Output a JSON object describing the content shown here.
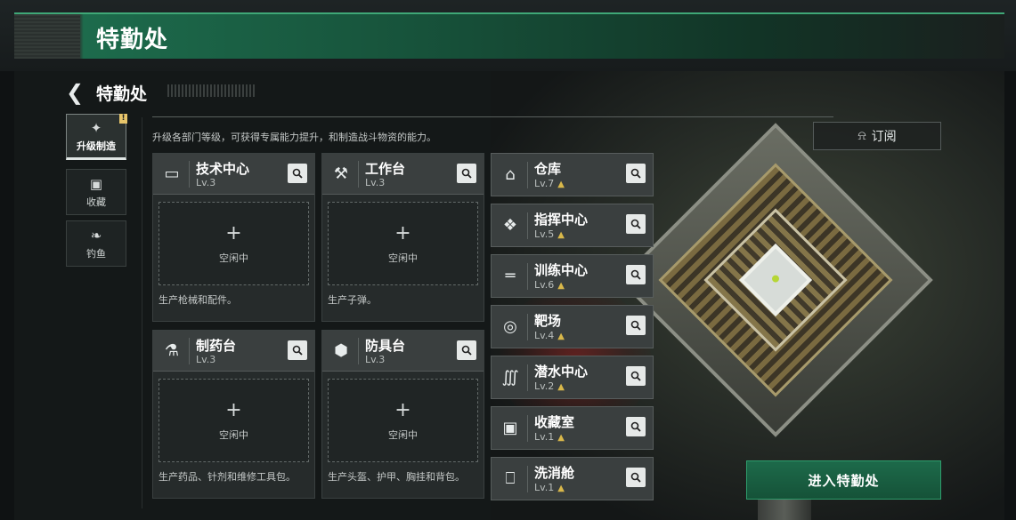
{
  "header": {
    "title": "特勤处"
  },
  "subheader": {
    "back_icon": "back-chevron-icon",
    "title": "特勤处"
  },
  "description": "升级各部门等级，可获得专属能力提升，和制造战斗物资的能力。",
  "side_tabs": [
    {
      "label": "升级制造",
      "icon": "craft-upgrade-icon",
      "active": true,
      "badge": "!"
    },
    {
      "label": "收藏",
      "icon": "collection-icon",
      "active": false
    },
    {
      "label": "钓鱼",
      "icon": "fish-icon",
      "active": false
    }
  ],
  "facilities": [
    {
      "name": "技术中心",
      "level": "Lv.3",
      "icon": "monitor-icon",
      "slot_status": "空闲中",
      "slot_plus": "+",
      "desc": "生产枪械和配件。"
    },
    {
      "name": "工作台",
      "level": "Lv.3",
      "icon": "tools-icon",
      "slot_status": "空闲中",
      "slot_plus": "+",
      "desc": "生产子弹。"
    },
    {
      "name": "制药台",
      "level": "Lv.3",
      "icon": "microscope-icon",
      "slot_status": "空闲中",
      "slot_plus": "+",
      "desc": "生产药品、针剂和维修工具包。"
    },
    {
      "name": "防具台",
      "level": "Lv.3",
      "icon": "armor-boxes-icon",
      "slot_status": "空闲中",
      "slot_plus": "+",
      "desc": "生产头盔、护甲、胸挂和背包。"
    }
  ],
  "rooms": [
    {
      "name": "仓库",
      "level": "Lv.7",
      "icon": "warehouse-icon"
    },
    {
      "name": "指挥中心",
      "level": "Lv.5",
      "icon": "chip-icon"
    },
    {
      "name": "训练中心",
      "level": "Lv.6",
      "icon": "dumbbell-icon"
    },
    {
      "name": "靶场",
      "level": "Lv.4",
      "icon": "target-icon"
    },
    {
      "name": "潜水中心",
      "level": "Lv.2",
      "icon": "diving-mask-icon"
    },
    {
      "name": "收藏室",
      "level": "Lv.1",
      "icon": "display-case-icon"
    },
    {
      "name": "洗消舱",
      "level": "Lv.1",
      "icon": "decon-chamber-icon"
    }
  ],
  "subscribe": {
    "label": "订阅",
    "icon": "bell-plus-icon"
  },
  "enter_button": {
    "label": "进入特勤处"
  },
  "colors": {
    "accent_green": "#1d6a4a",
    "upgrade_arrow": "#d9b84a"
  }
}
